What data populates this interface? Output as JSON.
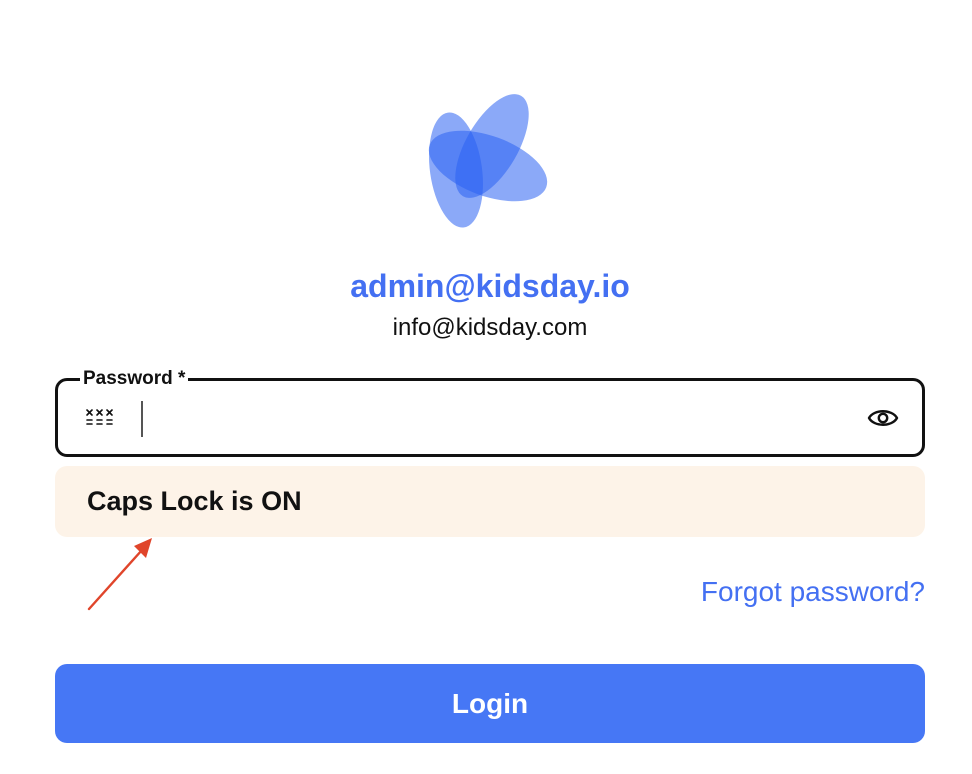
{
  "account": {
    "primary_email": "admin@kidsday.io",
    "secondary_email": "info@kidsday.com"
  },
  "password_field": {
    "label": "Password *",
    "value": "",
    "placeholder": "",
    "leading_icon": "password-key-icon",
    "trailing_icon": "eye-icon"
  },
  "caps_warning": {
    "text": "Caps Lock is ON"
  },
  "links": {
    "forgot_password": "Forgot password?"
  },
  "actions": {
    "login_label": "Login"
  },
  "colors": {
    "brand_blue": "#4470f2",
    "button_blue": "#4677f5",
    "warning_bg": "#fdf3e8",
    "annotation_arrow": "#e0452b"
  }
}
